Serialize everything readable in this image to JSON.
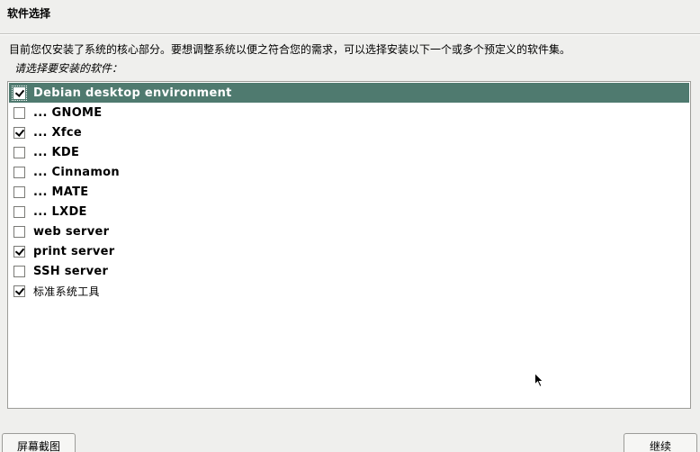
{
  "header": {
    "title": "软件选择"
  },
  "main": {
    "description": "目前您仅安装了系统的核心部分。要想调整系统以便之符合您的需求，可以选择安装以下一个或多个预定义的软件集。",
    "prompt": "请选择要安装的软件：",
    "tasks": [
      {
        "label": "Debian desktop environment",
        "checked": true,
        "selected": true
      },
      {
        "label": "... GNOME",
        "checked": false,
        "selected": false
      },
      {
        "label": "... Xfce",
        "checked": true,
        "selected": false
      },
      {
        "label": "... KDE",
        "checked": false,
        "selected": false
      },
      {
        "label": "... Cinnamon",
        "checked": false,
        "selected": false
      },
      {
        "label": "... MATE",
        "checked": false,
        "selected": false
      },
      {
        "label": "... LXDE",
        "checked": false,
        "selected": false
      },
      {
        "label": "web server",
        "checked": false,
        "selected": false
      },
      {
        "label": "print server",
        "checked": true,
        "selected": false
      },
      {
        "label": "SSH server",
        "checked": false,
        "selected": false
      },
      {
        "label": "标准系统工具",
        "checked": true,
        "selected": false
      }
    ]
  },
  "footer": {
    "screenshot_label": "屏幕截图",
    "continue_label": "继续"
  },
  "colors": {
    "selected_row": "#4f7a6f",
    "background": "#efefed"
  },
  "icons": {
    "checkbox": "checkbox-icon",
    "cursor": "mouse-pointer-icon"
  }
}
